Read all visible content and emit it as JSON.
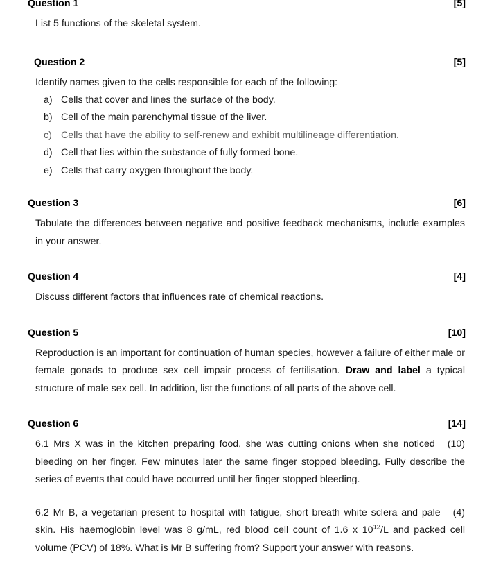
{
  "document": {
    "kind": "exam-question-paper"
  },
  "questions": [
    {
      "id": "q1",
      "title": "Question 1",
      "marks": "[5]",
      "body": "List 5 functions of the skeletal system."
    },
    {
      "id": "q2",
      "title": "Question 2",
      "marks": "[5]",
      "body": "Identify names given to the cells responsible for each of the following:",
      "items": [
        {
          "marker": "a)",
          "text": "Cells that cover and lines the surface of the body."
        },
        {
          "marker": "b)",
          "text": "Cell of the main parenchymal tissue of the liver."
        },
        {
          "marker": "c)",
          "text": "Cells that have the ability to self-renew and exhibit multilineage differentiation."
        },
        {
          "marker": "d)",
          "text": "Cell that lies within the substance of fully formed bone."
        },
        {
          "marker": "e)",
          "text": "Cells that carry oxygen throughout the body."
        }
      ]
    },
    {
      "id": "q3",
      "title": "Question 3",
      "marks": "[6]",
      "body": "Tabulate the differences between negative and positive feedback mechanisms, include examples in your answer."
    },
    {
      "id": "q4",
      "title": "Question 4",
      "marks": "[4]",
      "body": "Discuss different factors that influences rate of chemical reactions."
    },
    {
      "id": "q5",
      "title": "Question 5",
      "marks": "[10]",
      "body_part1": "Reproduction is an important for continuation of human species, however a failure of either male or female gonads to produce sex cell impair process of fertilisation. ",
      "body_emphasis": "Draw and label",
      "body_part2": " a typical structure of male sex cell. In addition, list the functions of all parts of the above cell."
    },
    {
      "id": "q6",
      "title": "Question 6",
      "marks": "[14]",
      "subquestions": [
        {
          "id": "q6-1",
          "label": "6.1",
          "text": "6.1 Mrs X was in the kitchen preparing food, she was cutting onions when she noticed bleeding on her finger. Few minutes later the same finger stopped bleeding. Fully describe the series of events that could have occurred until her finger stopped bleeding.",
          "marks": "(10)"
        },
        {
          "id": "q6-2",
          "label": "6.2",
          "text_before_sup": "6.2 Mr B, a vegetarian present to hospital with fatigue, short breath white sclera and pale skin. His haemoglobin level was 8 g/mL, red blood cell count of 1.6 x 10",
          "superscript": "12",
          "text_after_sup": "/L and packed cell volume (PCV)  of 18%.  What is Mr B suffering from? Support your answer with reasons.",
          "marks": "(4)"
        }
      ]
    }
  ],
  "colors": {
    "text": "#1a1a1a",
    "heading": "#000000",
    "faded_item": "#5a5a5a",
    "background": "#ffffff"
  }
}
